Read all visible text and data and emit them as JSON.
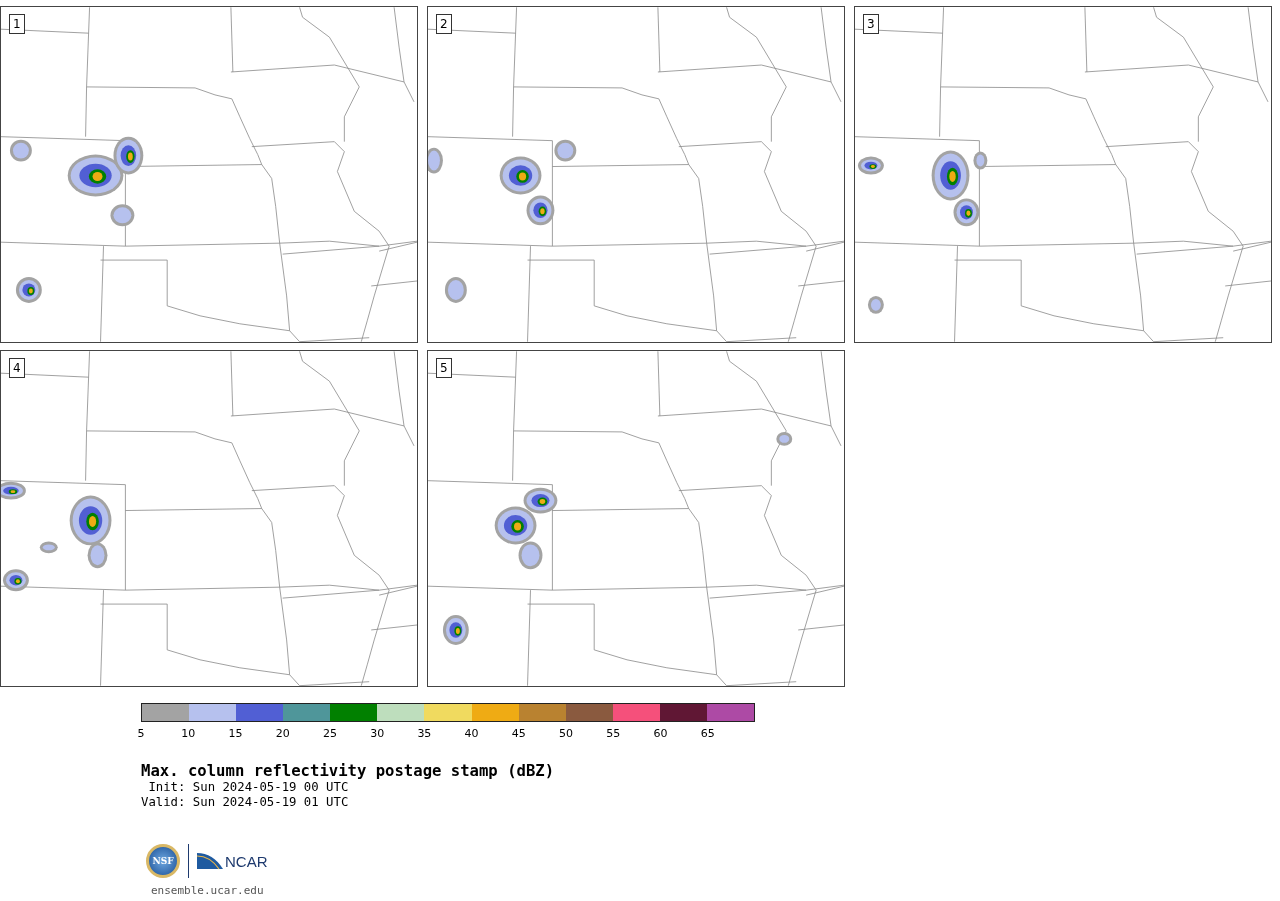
{
  "panels": [
    {
      "label": "1"
    },
    {
      "label": "2"
    },
    {
      "label": "3"
    },
    {
      "label": "4"
    },
    {
      "label": "5"
    }
  ],
  "colorbar": {
    "bins": [
      {
        "color": "#a3a3a3"
      },
      {
        "color": "#b6c1ee"
      },
      {
        "color": "#515fd4"
      },
      {
        "color": "#4f969a"
      },
      {
        "color": "#018000"
      },
      {
        "color": "#bedebd"
      },
      {
        "color": "#f0da5f"
      },
      {
        "color": "#efab14"
      },
      {
        "color": "#b98230"
      },
      {
        "color": "#8a5a3f"
      },
      {
        "color": "#f5507b"
      },
      {
        "color": "#601734"
      },
      {
        "color": "#ad4aa5"
      }
    ],
    "ticks": [
      "5",
      "10",
      "15",
      "20",
      "25",
      "30",
      "35",
      "40",
      "45",
      "50",
      "55",
      "60",
      "65"
    ]
  },
  "title": "Max. column reflectivity postage stamp (dBZ)",
  "init": " Init: Sun 2024-05-19 00 UTC",
  "valid": "Valid: Sun 2024-05-19 01 UTC",
  "logo": {
    "nsf": "NSF",
    "ncar": "NCAR"
  },
  "site": "ensemble.ucar.edu"
}
